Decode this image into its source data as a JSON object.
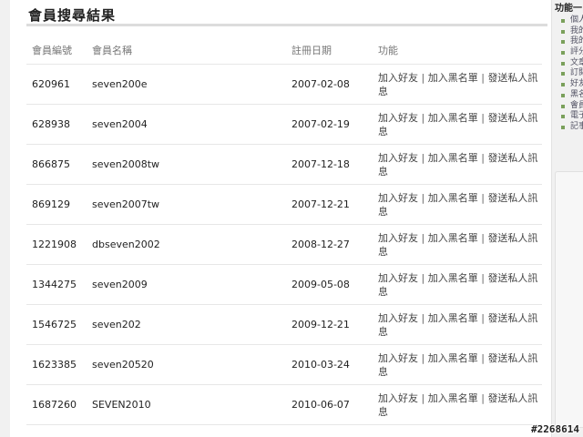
{
  "page": {
    "title": "會員搜尋結果"
  },
  "table": {
    "headers": [
      "會員編號",
      "會員名稱",
      "註冊日期",
      "功能"
    ],
    "actions": {
      "add_friend": "加入好友",
      "blacklist": "加入黑名單",
      "send_message": "發送私人訊息",
      "separator": "|"
    },
    "rows": [
      {
        "id": "620961",
        "name": "seven200e",
        "date": "2007-02-08"
      },
      {
        "id": "628938",
        "name": "seven2004",
        "date": "2007-02-19"
      },
      {
        "id": "866875",
        "name": "seven2008tw",
        "date": "2007-12-18"
      },
      {
        "id": "869129",
        "name": "seven2007tw",
        "date": "2007-12-21"
      },
      {
        "id": "1221908",
        "name": "dbseven2002",
        "date": "2008-12-27"
      },
      {
        "id": "1344275",
        "name": "seven2009",
        "date": "2009-05-08"
      },
      {
        "id": "1546725",
        "name": "seven202",
        "date": "2009-12-21"
      },
      {
        "id": "1623385",
        "name": "seven20520",
        "date": "2010-03-24"
      },
      {
        "id": "1687260",
        "name": "SEVEN2010",
        "date": "2010-06-07"
      }
    ]
  },
  "sidebar": {
    "title": "功能一",
    "items": [
      "個人",
      "我的",
      "我的",
      "評分",
      "文章",
      "訂閱",
      "好友",
      "黑名",
      "會員",
      "電子",
      "記事"
    ]
  },
  "watermark": "#2268614"
}
